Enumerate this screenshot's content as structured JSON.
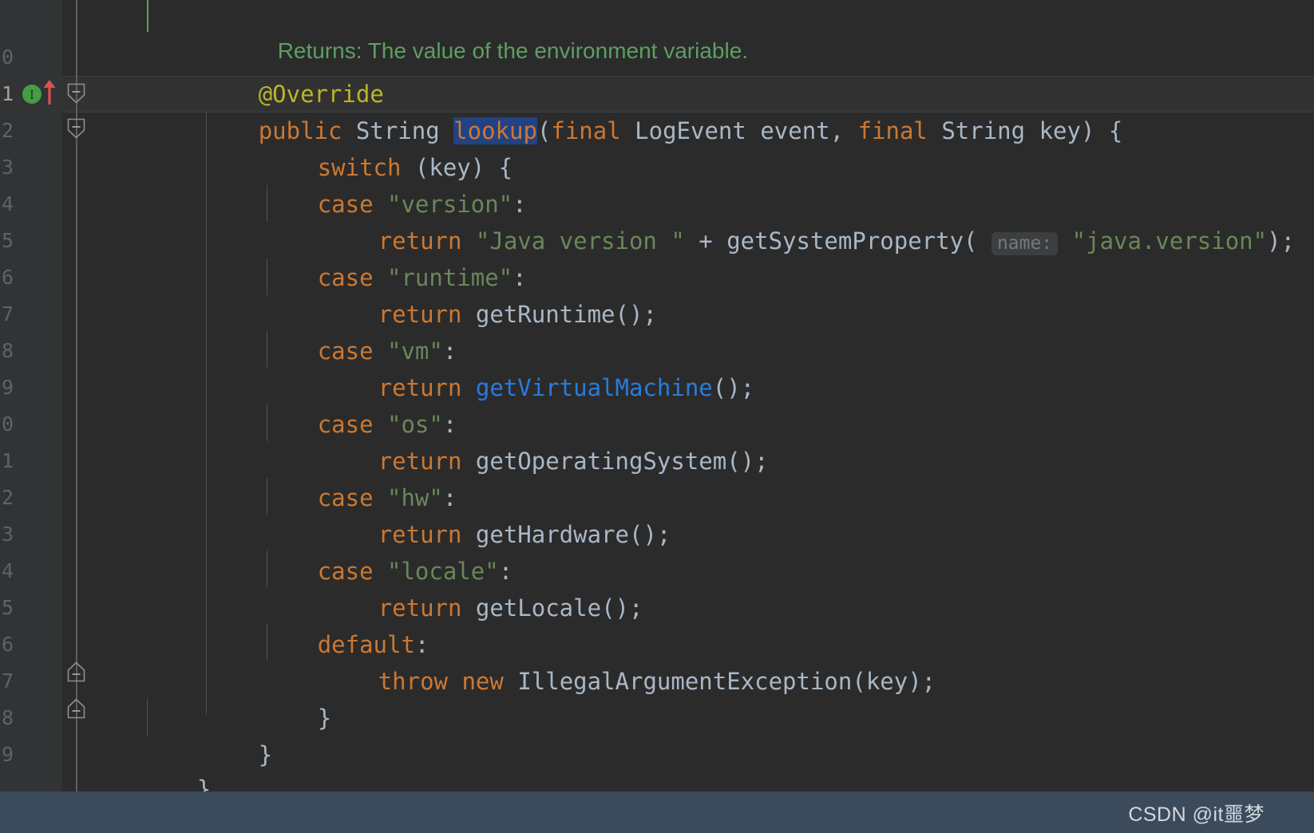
{
  "editor": {
    "theme_name": "darcula",
    "background": "#2b2b2b",
    "gutter_background": "#313335",
    "current_line_background": "#323232",
    "selection_background": "#214283",
    "accent_link_color": "#287bde",
    "keyword_color": "#cc7832",
    "string_color": "#6a8759",
    "annotation_color": "#bbb529",
    "identifier_color": "#a9b7c6",
    "javadoc_color": "#5e9e62",
    "current_line_number": "1",
    "line_numbers": [
      "0",
      "1",
      "2",
      "3",
      "4",
      "5",
      "6",
      "7",
      "8",
      "9",
      "0",
      "1",
      "2",
      "3",
      "4",
      "5",
      "6",
      "7",
      "8",
      "9"
    ],
    "gutter_markers": {
      "implementing_method_icon": "implementing-method-icon",
      "implementing_method_glyph": "I",
      "implementing_method_color": "#459e41",
      "overriding_method_icon": "override-arrow-icon",
      "overriding_method_color": "#d9534f",
      "fold_collapse_icon": "fold-collapse-icon",
      "fold_expand_up_icon": "fold-end-icon"
    },
    "inlay_hint": {
      "label": "name:",
      "background": "#3b3f41",
      "text_color": "#787878"
    },
    "selected_token": "lookup",
    "lines": [
      {
        "n": "",
        "indent": 0,
        "kind": "javadoc",
        "text": "Returns: The value of the environment variable."
      },
      {
        "n": "0",
        "indent": 0,
        "kind": "annotation",
        "text": "@Override"
      },
      {
        "n": "1",
        "indent": 0,
        "kind": "signature",
        "text": "public String lookup(final LogEvent event, final String key) {"
      },
      {
        "n": "2",
        "indent": 1,
        "kind": "code",
        "text": "switch (key) {"
      },
      {
        "n": "3",
        "indent": 2,
        "kind": "code",
        "text": "case \"version\":"
      },
      {
        "n": "4",
        "indent": 3,
        "kind": "code",
        "text": "return \"Java version \" + getSystemProperty( name: \"java.version\");"
      },
      {
        "n": "5",
        "indent": 2,
        "kind": "code",
        "text": "case \"runtime\":"
      },
      {
        "n": "6",
        "indent": 3,
        "kind": "code",
        "text": "return getRuntime();"
      },
      {
        "n": "7",
        "indent": 2,
        "kind": "code",
        "text": "case \"vm\":"
      },
      {
        "n": "8",
        "indent": 3,
        "kind": "code",
        "text": "return getVirtualMachine();"
      },
      {
        "n": "9",
        "indent": 2,
        "kind": "code",
        "text": "case \"os\":"
      },
      {
        "n": "0",
        "indent": 3,
        "kind": "code",
        "text": "return getOperatingSystem();"
      },
      {
        "n": "1",
        "indent": 2,
        "kind": "code",
        "text": "case \"hw\":"
      },
      {
        "n": "2",
        "indent": 3,
        "kind": "code",
        "text": "return getHardware();"
      },
      {
        "n": "3",
        "indent": 2,
        "kind": "code",
        "text": "case \"locale\":"
      },
      {
        "n": "4",
        "indent": 3,
        "kind": "code",
        "text": "return getLocale();"
      },
      {
        "n": "5",
        "indent": 2,
        "kind": "code",
        "text": "default:"
      },
      {
        "n": "6",
        "indent": 3,
        "kind": "code",
        "text": "throw new IllegalArgumentException(key);"
      },
      {
        "n": "7",
        "indent": 2,
        "kind": "code",
        "text": "}"
      },
      {
        "n": "8",
        "indent": 1,
        "kind": "code",
        "text": "}"
      },
      {
        "n": "9",
        "indent": 0,
        "kind": "code",
        "text": "}"
      }
    ],
    "tokens": {
      "javadoc_line": "Returns: The value of the environment variable.",
      "annotation": "@Override",
      "kw_public": "public",
      "type_String": "String",
      "method_lookup": "lookup",
      "kw_final": "final",
      "type_LogEvent": "LogEvent",
      "param_event": "event",
      "param_key": "key",
      "kw_switch": "switch",
      "kw_case": "case",
      "kw_return": "return",
      "kw_default": "default",
      "kw_throw": "throw",
      "kw_new": "new",
      "str_version": "\"version\"",
      "str_runtime": "\"runtime\"",
      "str_vm": "\"vm\"",
      "str_os": "\"os\"",
      "str_hw": "\"hw\"",
      "str_locale": "\"locale\"",
      "str_java_version_prefix": "\"Java version \"",
      "str_java_version_prop": "\"java.version\"",
      "fn_getSystemProperty": "getSystemProperty",
      "fn_getRuntime": "getRuntime",
      "fn_getVirtualMachine": "getVirtualMachine",
      "fn_getOperatingSystem": "getOperatingSystem",
      "fn_getHardware": "getHardware",
      "fn_getLocale": "getLocale",
      "ex_IllegalArgumentException": "IllegalArgumentException"
    }
  },
  "status_bar": {
    "background": "#3c4b5c",
    "watermark": "CSDN @it噩梦"
  }
}
